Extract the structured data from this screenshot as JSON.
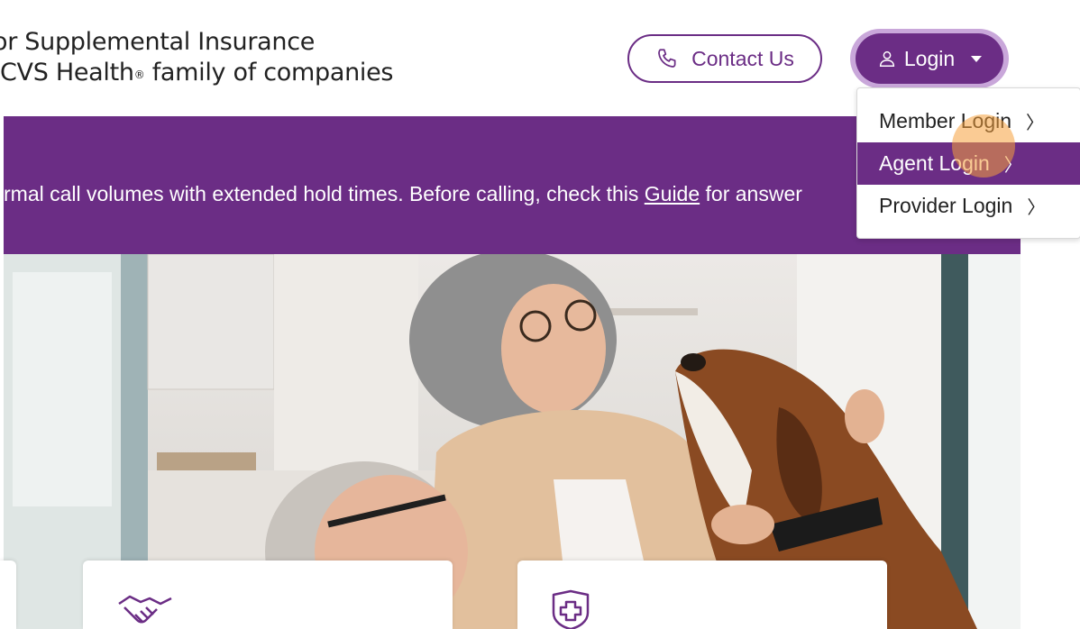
{
  "header": {
    "brand_line1": "or Supplemental Insurance",
    "brand_line2_prefix": " CVS Health",
    "brand_sup": "®",
    "brand_line2_suffix": " family of companies",
    "contact_label": "Contact Us",
    "login_label": "Login"
  },
  "banner": {
    "text_before": "rmal call volumes with extended hold times. Before calling, check this ",
    "link_text": "Guide",
    "text_after": " for answer"
  },
  "login_menu": {
    "items": [
      {
        "label": "Member Login",
        "chevron": "〉"
      },
      {
        "label": "Agent Login",
        "chevron": "〉"
      },
      {
        "label": "Provider Login",
        "chevron": "〉"
      }
    ]
  },
  "hero": {
    "image": "older-couple-with-beagle-dog"
  },
  "colors": {
    "brand_purple": "#6b2d85",
    "click_indicator": "#f5a03c"
  },
  "icons": [
    "phone-icon",
    "user-icon",
    "caret-down-icon",
    "handshake-icon",
    "shield-plus-icon"
  ]
}
